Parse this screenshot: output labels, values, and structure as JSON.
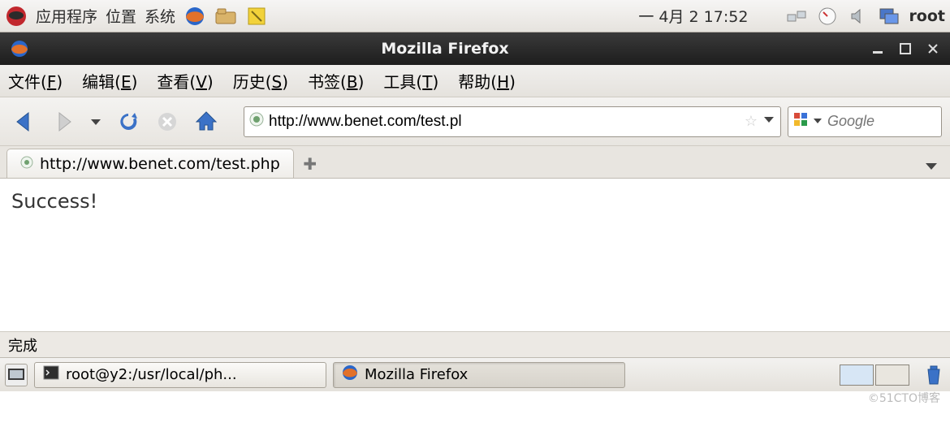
{
  "gnome": {
    "menu_apps": "应用程序",
    "menu_places": "位置",
    "menu_system": "系统",
    "clock": "一  4月  2 17:52",
    "user": "root"
  },
  "window": {
    "title": "Mozilla Firefox"
  },
  "menubar": {
    "file": "文件(",
    "file_k": "F",
    "edit": "编辑(",
    "edit_k": "E",
    "view": "查看(",
    "view_k": "V",
    "history": "历史(",
    "history_k": "S",
    "bookmarks": "书签(",
    "bookmarks_k": "B",
    "tools": "工具(",
    "tools_k": "T",
    "help": "帮助(",
    "help_k": "H",
    "close": ")"
  },
  "toolbar": {
    "address": "http://www.benet.com/test.pl",
    "search_placeholder": "Google"
  },
  "tabs": {
    "active_label": "http://www.benet.com/test.php"
  },
  "page": {
    "content": "Success!"
  },
  "statusbar": {
    "text": "完成"
  },
  "taskbar": {
    "terminal": "root@y2:/usr/local/ph...",
    "firefox": "Mozilla Firefox"
  },
  "watermark": "©51CTO博客"
}
